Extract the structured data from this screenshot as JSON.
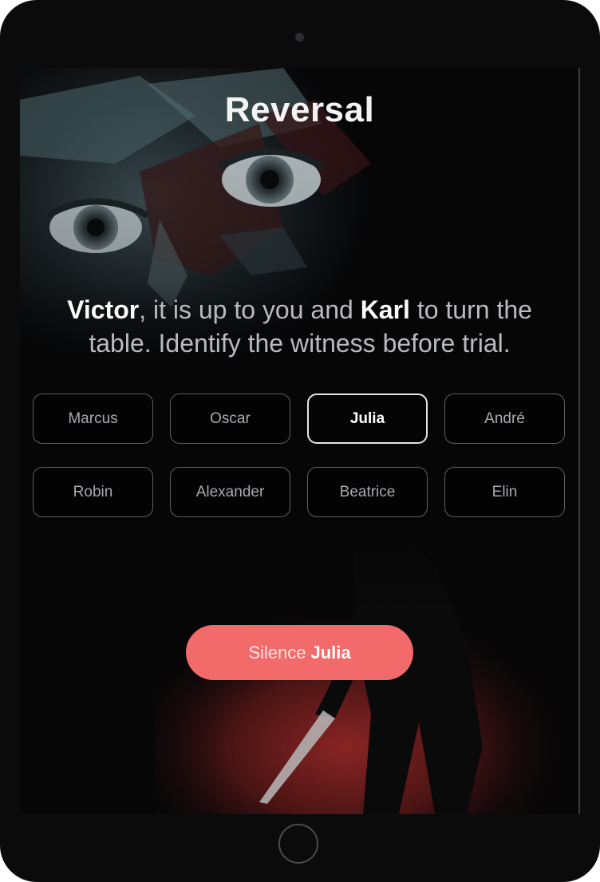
{
  "game": {
    "title": "Reversal",
    "prompt": {
      "player": "Victor",
      "text_a": ", it is up to you and ",
      "partner": "Karl",
      "text_b": " to turn the table. Identify the witness before trial."
    },
    "choices": [
      {
        "label": "Marcus",
        "selected": false
      },
      {
        "label": "Oscar",
        "selected": false
      },
      {
        "label": "Julia",
        "selected": true
      },
      {
        "label": "André",
        "selected": false
      },
      {
        "label": "Robin",
        "selected": false
      },
      {
        "label": "Alexander",
        "selected": false
      },
      {
        "label": "Beatrice",
        "selected": false
      },
      {
        "label": "Elin",
        "selected": false
      }
    ],
    "action": {
      "verb": "Silence",
      "target": "Julia"
    }
  },
  "colors": {
    "device_frame": "#0b0b0c",
    "screen_background": "#060607",
    "action_button": "#f36a6b",
    "selected_border": "#e6e6e6",
    "choice_border": "#5d5f63"
  }
}
